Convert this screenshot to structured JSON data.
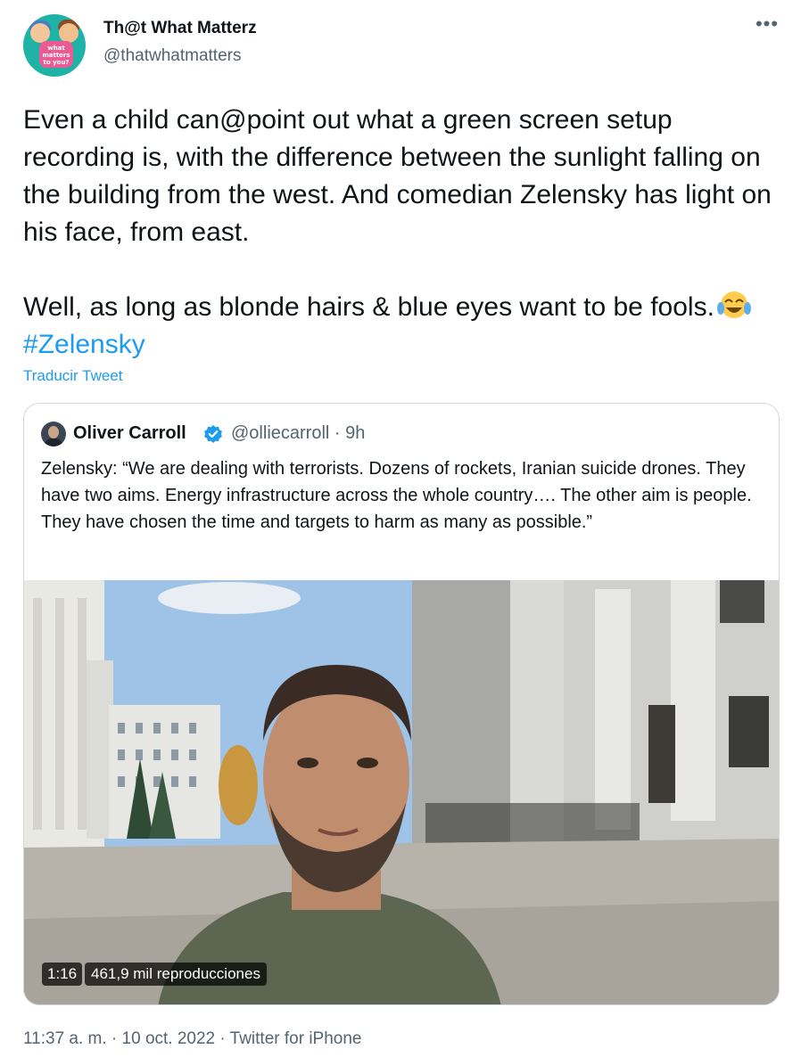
{
  "author": {
    "display_name": "Th@t What Matterz",
    "handle": "@thatwhatmatters",
    "avatar_text": "what matters to you?"
  },
  "more_icon": "ellipsis-icon",
  "tweet": {
    "text_p1": "Even a child can@point out what a green screen setup recording is, with the difference between the sunlight falling on the building from the west. And comedian Zelensky has light on his face, from east.",
    "text_p2_before": "Well, as long as blonde hairs & blue eyes want to be fools.",
    "emoji": "face-with-tears-of-joy-icon",
    "hashtag": "#Zelensky"
  },
  "translate_link": "Traducir Tweet",
  "quoted": {
    "name": "Oliver Carroll",
    "verified_icon": "verified-badge-icon",
    "meta": "@olliecarroll · 9h",
    "text": "Zelensky: “We are dealing with terrorists. Dozens of rockets, Iranian suicide drones. They have two aims. Energy infrastructure across the whole country…. The other aim is people. They have chosen the time and targets to harm as many as possible.”",
    "video": {
      "duration": "1:16",
      "views": "461,9 mil reproducciones"
    }
  },
  "timestamp": "11:37 a. m. · 10 oct. 2022 · Twitter for iPhone",
  "colors": {
    "accent": "#1d9bf0",
    "text": "#0f1419",
    "secondary": "#536471",
    "border": "#cfd9de"
  }
}
